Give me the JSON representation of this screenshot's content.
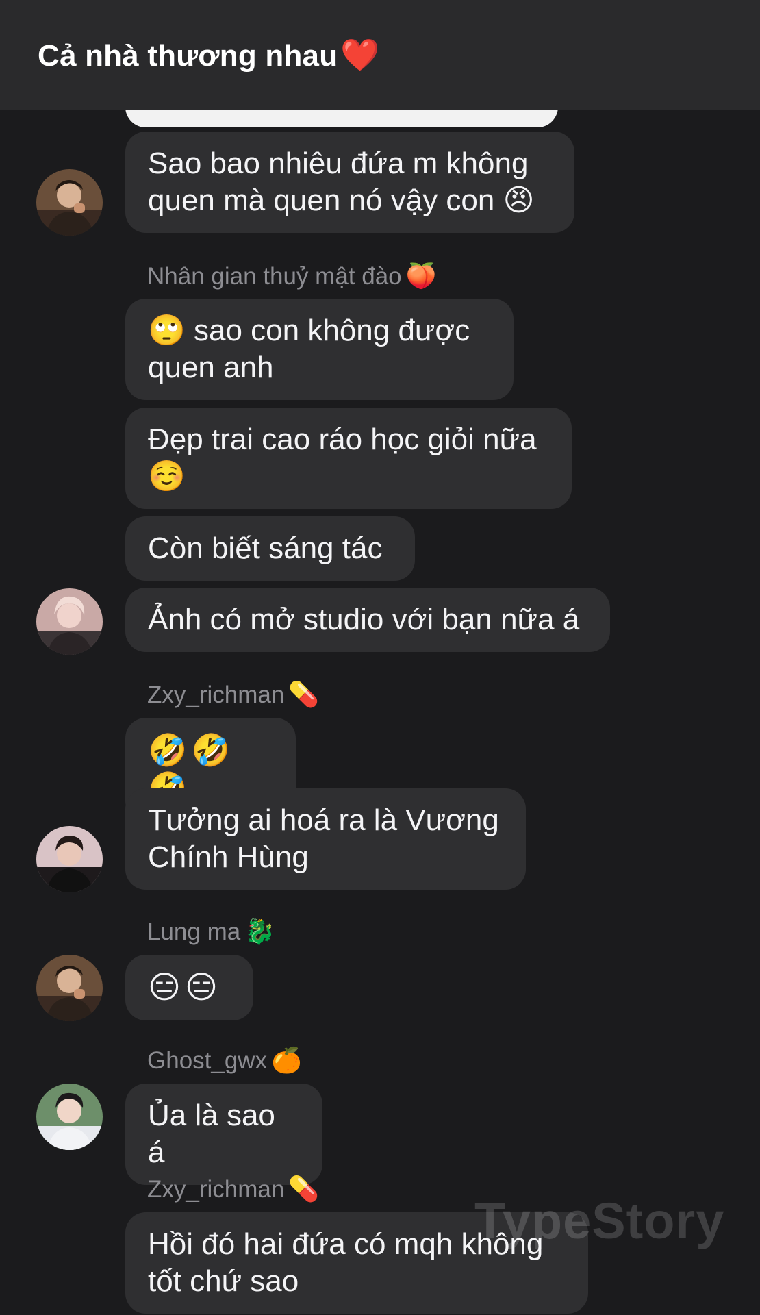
{
  "header": {
    "title": "Cả nhà thương nhau",
    "title_icon": "❤️"
  },
  "messages": {
    "m1": "Sao bao nhiêu đứa m không quen mà quen nó vậy con 😠",
    "m2": "🙄 sao con không được quen anh",
    "m3": "Đẹp trai cao ráo học giỏi nữa ☺️",
    "m4": "Còn biết sáng tác",
    "m5": "Ảnh có mở studio với bạn nữa á",
    "m6": "🤣🤣🤣",
    "m7": "Tưởng ai hoá ra là Vương Chính Hùng",
    "m8": "😑😑",
    "m9": "Ủa là sao á",
    "m10": "Hồi đó hai đứa có mqh không tốt chứ sao"
  },
  "senders": {
    "s1": {
      "name": "Nhân gian thuỷ mật đào",
      "icon": "🍑"
    },
    "s2": {
      "name": "Zxy_richman",
      "icon": "💊"
    },
    "s3": {
      "name": "Lung ma",
      "icon": "🐉"
    },
    "s4": {
      "name": "Ghost_gwx",
      "icon": "🍊"
    },
    "s5": {
      "name": "Zxy_richman",
      "icon": "💊"
    }
  },
  "watermark": "TypeStory",
  "colors": {
    "background": "#1b1b1d",
    "header": "#2a2a2c",
    "bubble": "#2f2f31",
    "sender_text": "#8d8d92",
    "message_text": "#f4f4f6"
  }
}
